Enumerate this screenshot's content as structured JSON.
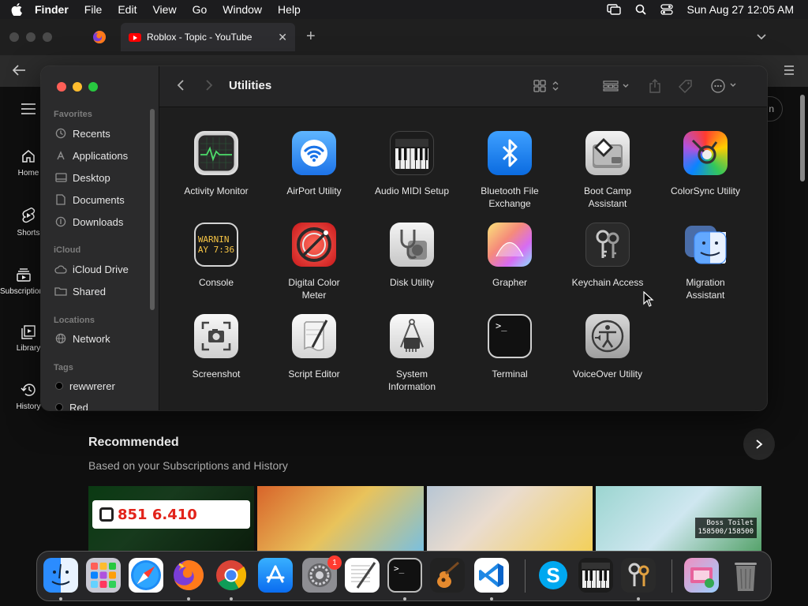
{
  "menubar": {
    "app_name": "Finder",
    "menus": [
      "File",
      "Edit",
      "View",
      "Go",
      "Window",
      "Help"
    ],
    "clock": "Sun Aug 27  12:05 AM"
  },
  "browser": {
    "tab_title": "Roblox - Topic - YouTube",
    "tab_close": "✕",
    "new_tab": "+"
  },
  "youtube": {
    "sidebar": [
      {
        "label": "Home",
        "icon": "home-icon"
      },
      {
        "label": "Shorts",
        "icon": "shorts-icon"
      },
      {
        "label": "Subscriptions",
        "icon": "subscriptions-icon"
      },
      {
        "label": "Library",
        "icon": "library-icon"
      },
      {
        "label": "History",
        "icon": "history-icon"
      }
    ],
    "avatar_letter": "n",
    "recommended_title": "Recommended",
    "recommended_sub": "Based on your Subscriptions and History",
    "thumb_robux": "851 6.410",
    "thumb_boss": "Boss Toilet\n158500/158500"
  },
  "finder": {
    "title": "Utilities",
    "sidebar": {
      "favorites_header": "Favorites",
      "favorites": [
        "Recents",
        "Applications",
        "Desktop",
        "Documents",
        "Downloads"
      ],
      "icloud_header": "iCloud",
      "icloud": [
        "iCloud Drive",
        "Shared"
      ],
      "locations_header": "Locations",
      "locations": [
        "Network"
      ],
      "tags_header": "Tags",
      "tags": [
        "rewwrerer",
        "Red"
      ]
    },
    "apps": [
      {
        "label": "Activity Monitor"
      },
      {
        "label": "AirPort Utility"
      },
      {
        "label": "Audio MIDI Setup"
      },
      {
        "label": "Bluetooth File\nExchange"
      },
      {
        "label": "Boot Camp\nAssistant"
      },
      {
        "label": "ColorSync Utility"
      },
      {
        "label": "Console"
      },
      {
        "label": "Digital Color\nMeter"
      },
      {
        "label": "Disk Utility"
      },
      {
        "label": "Grapher"
      },
      {
        "label": "Keychain Access"
      },
      {
        "label": "Migration\nAssistant"
      },
      {
        "label": "Screenshot"
      },
      {
        "label": "Script Editor"
      },
      {
        "label": "System\nInformation"
      },
      {
        "label": "Terminal"
      },
      {
        "label": "VoiceOver Utility"
      }
    ],
    "console_icon_text": "WARNIN\nAY 7:36"
  },
  "dock": {
    "apps": [
      "Finder",
      "Launchpad",
      "Safari",
      "Firefox",
      "Chrome",
      "App Store",
      "System Settings",
      "TextEdit",
      "Terminal",
      "GarageBand",
      "Visual Studio Code",
      "Skype",
      "Piano",
      "Keychain Access",
      "Downloads",
      "Trash"
    ],
    "settings_badge": "1"
  }
}
